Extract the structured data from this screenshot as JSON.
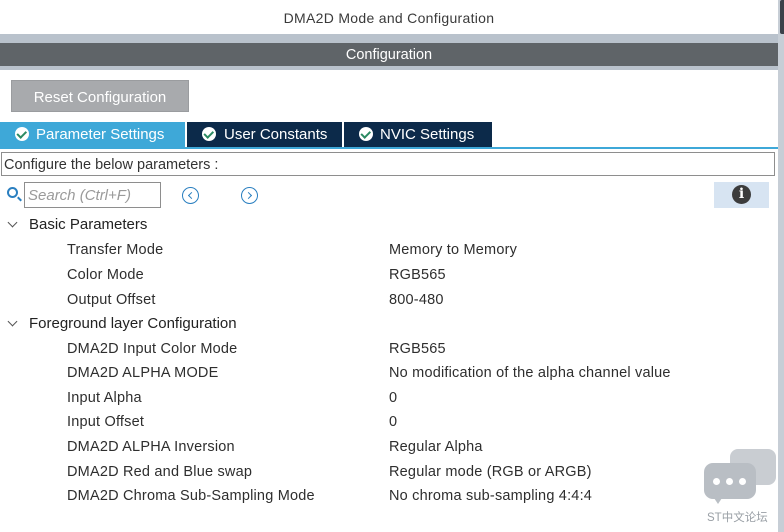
{
  "window": {
    "title": "DMA2D Mode and Configuration"
  },
  "header": {
    "section_title": "Configuration"
  },
  "toolbar": {
    "reset_label": "Reset Configuration"
  },
  "tabs": [
    {
      "label": "Parameter Settings",
      "active": true
    },
    {
      "label": "User Constants",
      "active": false
    },
    {
      "label": "NVIC Settings",
      "active": false
    }
  ],
  "instructions": "Configure the below parameters :",
  "search": {
    "placeholder": "Search (Ctrl+F)",
    "value": ""
  },
  "groups": [
    {
      "label": "Basic Parameters",
      "params": [
        {
          "name": "Transfer Mode",
          "value": "Memory to Memory"
        },
        {
          "name": "Color Mode",
          "value": "RGB565"
        },
        {
          "name": "Output Offset",
          "value": "800-480"
        }
      ]
    },
    {
      "label": "Foreground layer Configuration",
      "params": [
        {
          "name": "DMA2D Input Color Mode",
          "value": "RGB565"
        },
        {
          "name": "DMA2D ALPHA MODE",
          "value": "No modification of the alpha channel value"
        },
        {
          "name": "Input Alpha",
          "value": "0"
        },
        {
          "name": "Input Offset",
          "value": "0"
        },
        {
          "name": "DMA2D ALPHA Inversion",
          "value": "Regular Alpha"
        },
        {
          "name": "DMA2D Red and Blue swap",
          "value": "Regular mode (RGB or ARGB)"
        },
        {
          "name": "DMA2D Chroma Sub-Sampling Mode",
          "value": "No chroma sub-sampling 4:4:4"
        }
      ]
    }
  ],
  "watermark": {
    "text": "ST中文论坛"
  },
  "icons": {
    "tab_check": "check-circle-icon",
    "search": "search-icon",
    "prev": "chevron-left-icon",
    "next": "chevron-right-icon",
    "info": "info-icon",
    "group_toggle": "chevron-down-icon",
    "watermark": "chat-bubbles-icon"
  },
  "colors": {
    "active_tab": "#3ea8d8",
    "inactive_tab": "#0c2a4a",
    "section_bar": "#5f6468",
    "button": "#a8aaad",
    "accent_icon": "#2a7fc0",
    "info_background": "#d7e4f2"
  }
}
